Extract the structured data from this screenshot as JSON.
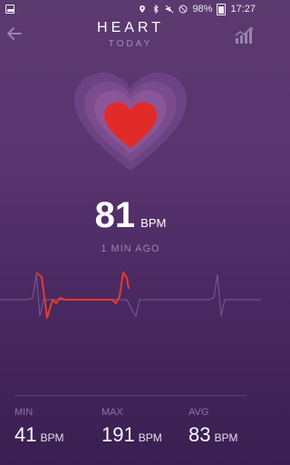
{
  "status_bar": {
    "battery": "98%",
    "time": "17:27"
  },
  "header": {
    "title": "HEART",
    "subtitle": "TODAY"
  },
  "reading": {
    "value": "81",
    "unit": "BPM",
    "ago": "1 MIN AGO"
  },
  "stats": [
    {
      "label": "MIN",
      "value": "41",
      "unit": "BPM"
    },
    {
      "label": "MAX",
      "value": "191",
      "unit": "BPM"
    },
    {
      "label": "AVG",
      "value": "83",
      "unit": "BPM"
    }
  ],
  "colors": {
    "heart": "#e12b2b",
    "ecg_active": "#e53b2b",
    "ecg_inactive": "#7b5b8e"
  }
}
